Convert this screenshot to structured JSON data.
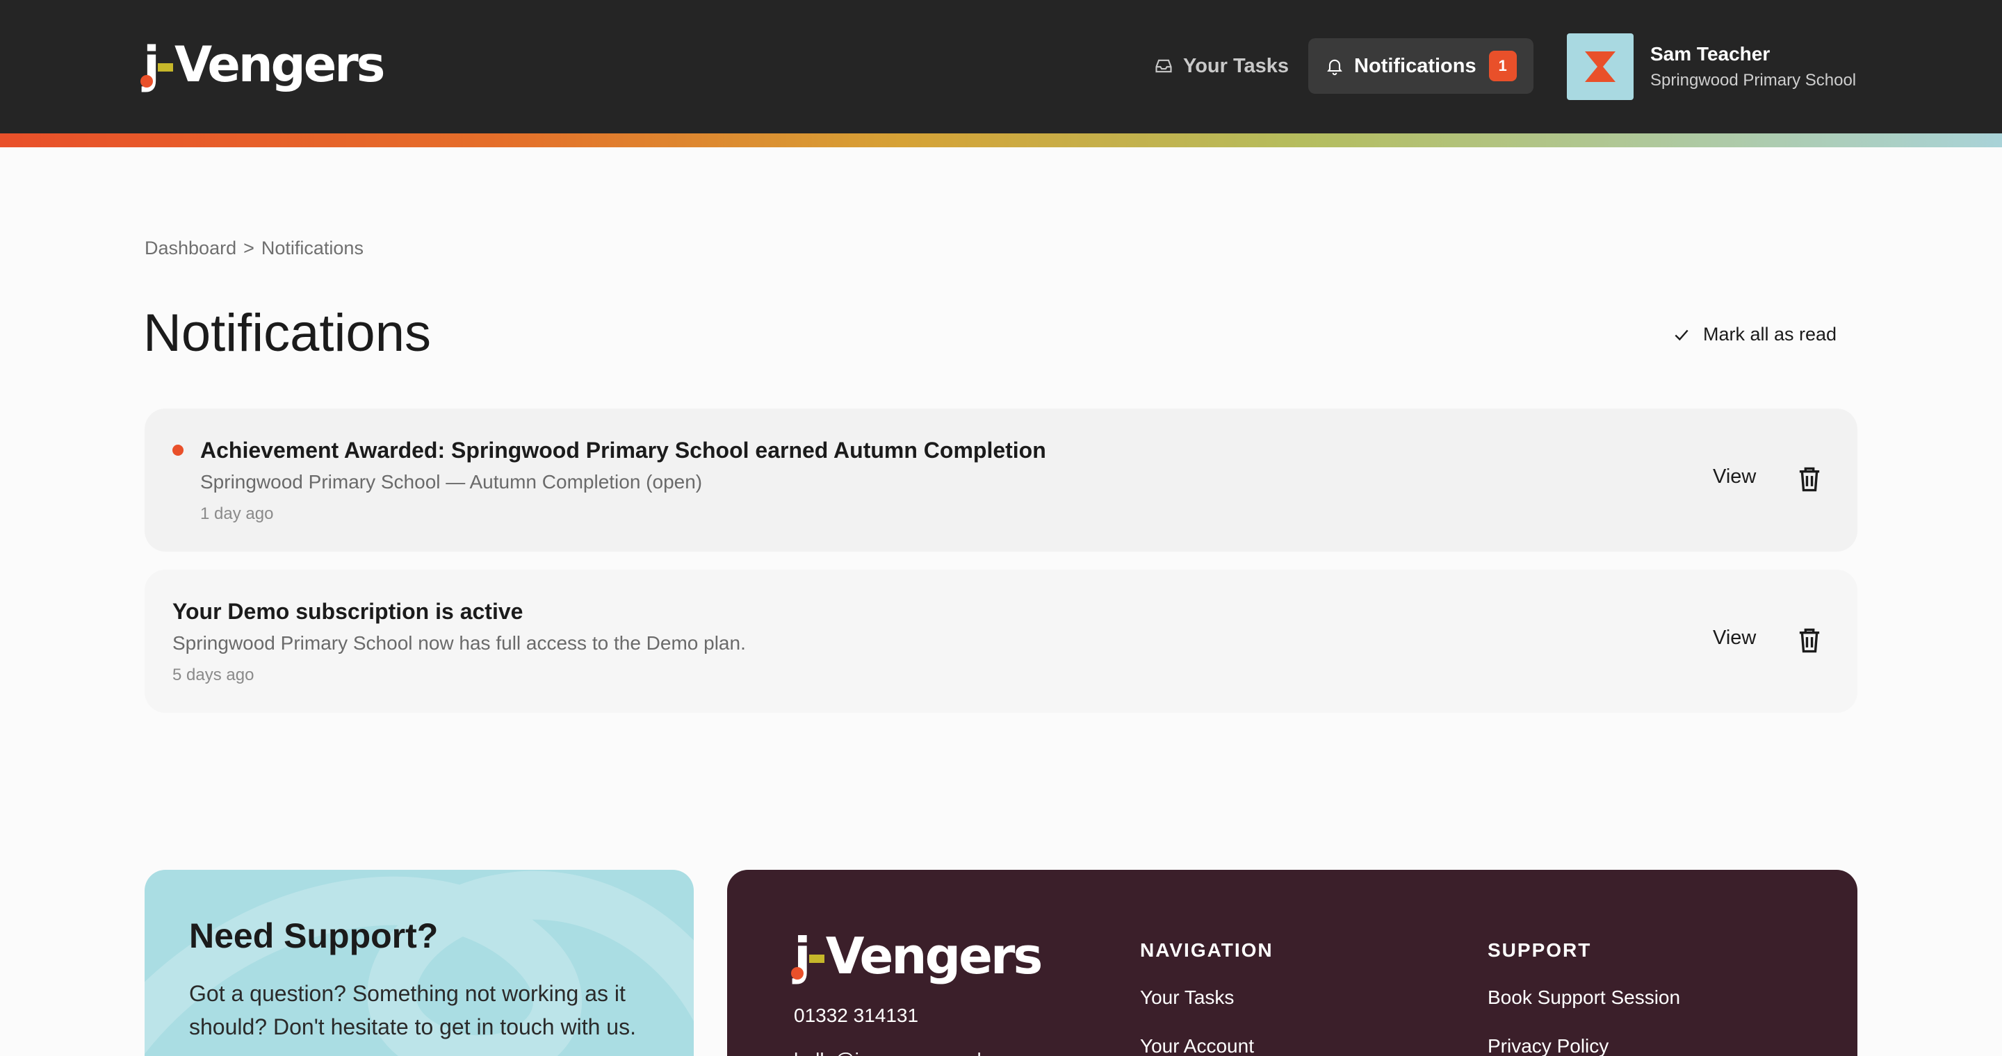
{
  "brand": {
    "logo_j": "j",
    "logo_rest": "Vengers"
  },
  "header": {
    "tasks_label": "Your Tasks",
    "notifications_label": "Notifications",
    "notifications_count": "1",
    "user_name": "Sam Teacher",
    "user_school": "Springwood Primary School"
  },
  "colors": {
    "header_bg": "#252525",
    "accent": "#e9502a",
    "support_bg": "#aadde3",
    "footer_bg": "#3b1f2a"
  },
  "breadcrumb": {
    "root": "Dashboard",
    "separator": ">",
    "current": "Notifications"
  },
  "page": {
    "title": "Notifications",
    "mark_all_label": "Mark all as read"
  },
  "notifications": [
    {
      "unread": true,
      "title": "Achievement Awarded: Springwood Primary School earned Autumn Completion",
      "description": "Springwood Primary School — Autumn Completion (open)",
      "time": "1 day ago",
      "view_label": "View"
    },
    {
      "unread": false,
      "title": "Your Demo subscription is active",
      "description": "Springwood Primary School now has full access to the Demo plan.",
      "time": "5 days ago",
      "view_label": "View"
    }
  ],
  "support": {
    "title": "Need Support?",
    "text": "Got a question? Something not working as it should? Don't hesitate to get in touch with us."
  },
  "footer": {
    "phone": "01332 314131",
    "email": "hello@j-vengers.co.uk",
    "navigation_heading": "NAVIGATION",
    "navigation_links": [
      "Your Tasks",
      "Your Account"
    ],
    "support_heading": "SUPPORT",
    "support_links": [
      "Book Support Session",
      "Privacy Policy"
    ]
  }
}
